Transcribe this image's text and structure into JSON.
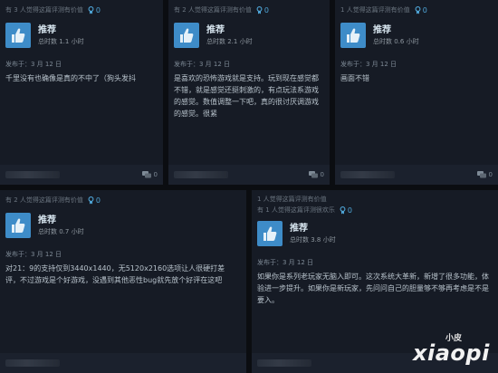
{
  "reviews": [
    {
      "helpful": "有 3 人觉得这篇评测有价值",
      "awards": "0",
      "recommend": "推荐",
      "hours": "总时数 1.1 小时",
      "posted": "发布于：3 月 12 日",
      "text": "千里没有也确像是真的不中了（狗头发抖",
      "comments": "0"
    },
    {
      "helpful": "有 2 人觉得这篇评测有价值",
      "awards": "0",
      "recommend": "推荐",
      "hours": "总时数 2.1 小时",
      "posted": "发布于：3 月 12 日",
      "text": "是喜欢的恐怖游戏就是支持。玩到现在感觉都不错，就是感觉还挺刺激的，有点玩法系游戏的感觉。数值调整一下吧，真的很讨厌调游戏的感觉。很紧",
      "comments": "0"
    },
    {
      "helpful": "1 人觉得这篇评测有价值",
      "awards": "0",
      "recommend": "推荐",
      "hours": "总时数 0.6 小时",
      "posted": "发布于：3 月 12 日",
      "text": "画面不错",
      "comments": "0"
    },
    {
      "helpful": "有 2 人觉得这篇评测有价值",
      "awards": "0",
      "recommend": "推荐",
      "hours": "总时数 0.7 小时",
      "posted": "发布于：3 月 12 日",
      "text": "对21：9的支持仅到3440x1440，无5120x2160选项让人很硬打差评，不过游戏是个好游戏，没遇到其他恶性bug就先放个好评在这吧",
      "comments": "0"
    },
    {
      "helpful": "1 人觉得这篇评测有价值",
      "helpful2": "有 1 人觉得这篇评测很欢乐",
      "awards": "0",
      "recommend": "推荐",
      "hours": "总时数 3.8 小时",
      "posted": "发布于：3 月 12 日",
      "text": "如果你是系列老玩家无脑入即可。这次系统大革新，新增了很多功能，体验进一步提升。如果你是新玩家，先问问自己的胆量够不够再考虑是不是要入。",
      "comments": "0"
    }
  ],
  "watermark": {
    "small": "小皮",
    "big": "xiaopi"
  },
  "colors": {
    "accent": "#3e8cc8",
    "card": "#161b25",
    "footer": "#1b212d"
  }
}
